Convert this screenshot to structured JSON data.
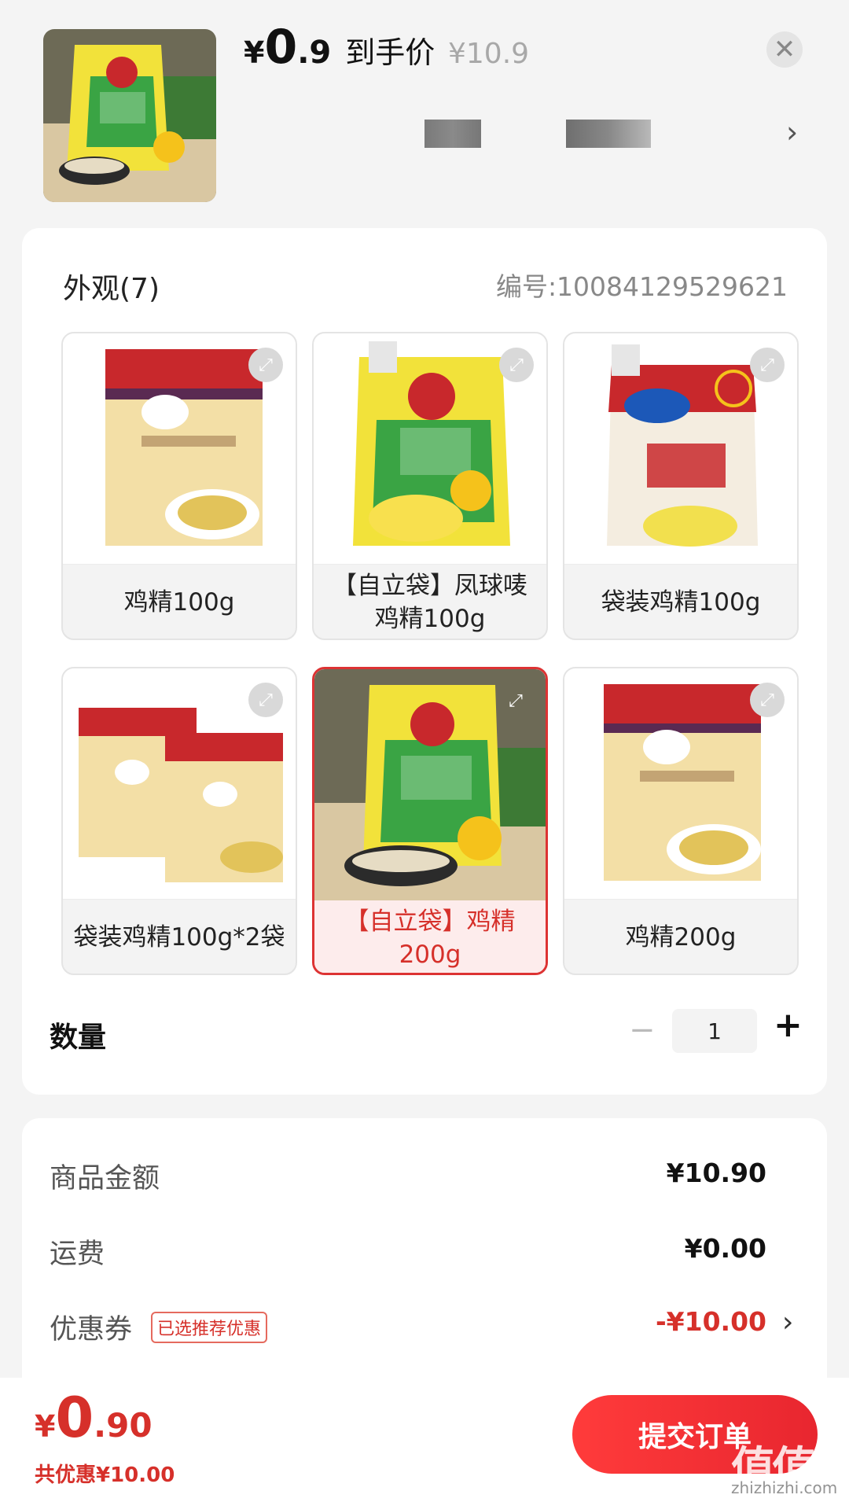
{
  "header": {
    "price_yen": "¥",
    "price_int": "0",
    "price_dec": ".9",
    "price_label": "到手价",
    "original_price": "¥10.9",
    "close_icon": "✕",
    "chevron": "›"
  },
  "appearance": {
    "title": "外观(7)",
    "sku_number": "编号:10084129529621",
    "options": [
      {
        "label": "鸡精100g",
        "selected": false
      },
      {
        "label": "【自立袋】凤球唛鸡精100g",
        "selected": false
      },
      {
        "label": "袋装鸡精100g",
        "selected": false
      },
      {
        "label": "袋装鸡精100g*2袋",
        "selected": false
      },
      {
        "label": "【自立袋】鸡精200g",
        "selected": true
      },
      {
        "label": "鸡精200g",
        "selected": false
      }
    ]
  },
  "quantity": {
    "label": "数量",
    "minus": "−",
    "value": "1",
    "plus": "+"
  },
  "summary": {
    "goods_amount_label": "商品金额",
    "goods_amount": "¥10.90",
    "shipping_label": "运费",
    "shipping": "¥0.00",
    "coupon_label": "优惠券",
    "coupon_tag": "已选推荐优惠",
    "coupon_value": "-¥10.00",
    "coupon_chevron": "›"
  },
  "footer": {
    "total_yen": "¥",
    "total_int": "0",
    "total_dec": ".90",
    "total_saving": "共优惠¥10.00",
    "submit_label": "提交订单"
  },
  "watermark": {
    "main": "值值值",
    "sub": "zhizhizhi.com"
  },
  "colors": {
    "accent": "#d6302a",
    "package_yellow": "#f2e23a",
    "package_green": "#3aa444",
    "package_red": "#c8282c",
    "package_cream": "#f3dfa6"
  }
}
